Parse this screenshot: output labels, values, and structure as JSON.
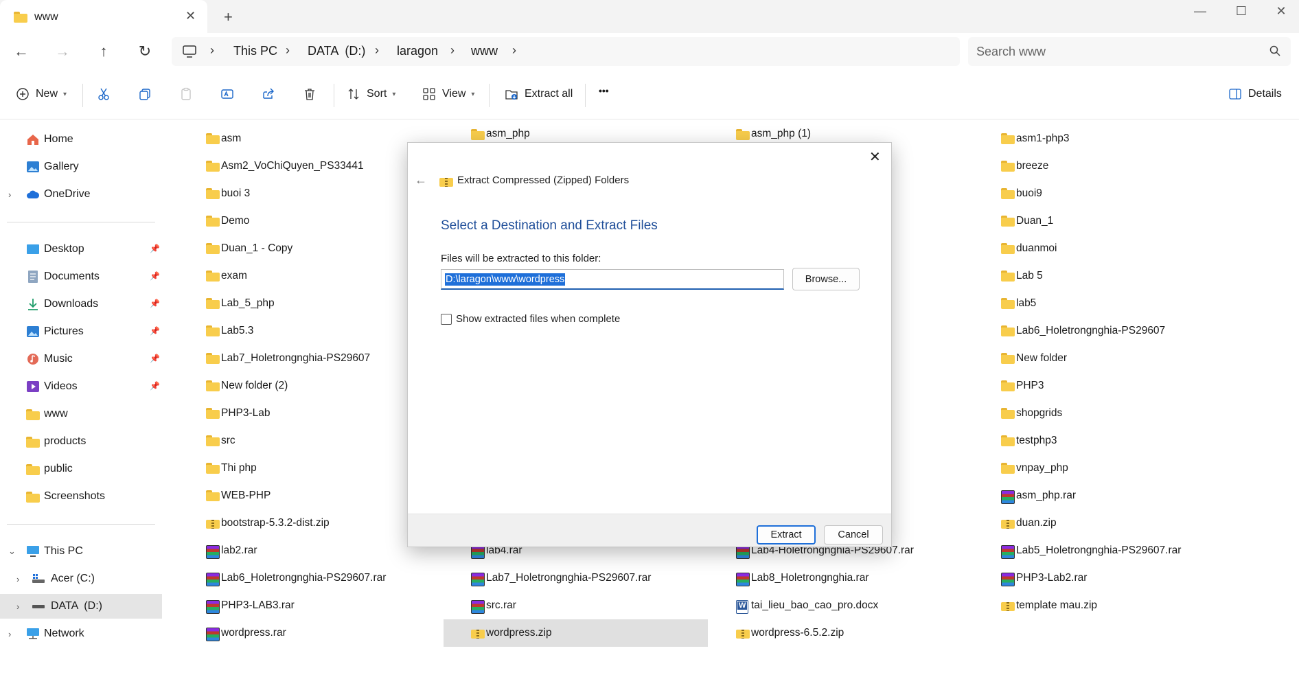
{
  "tab": {
    "title": "www",
    "close": "✕",
    "new_tab": "+"
  },
  "window_controls": {
    "minimize": "—",
    "maximize": "☐",
    "close": "✕"
  },
  "nav": {
    "back": "←",
    "forward": "→",
    "up": "↑",
    "refresh": "↻"
  },
  "breadcrumb": [
    {
      "label": "This PC"
    },
    {
      "label": "DATA  (D:)"
    },
    {
      "label": "laragon"
    },
    {
      "label": "www"
    }
  ],
  "breadcrumb_sep": "›",
  "search": {
    "placeholder": "Search www"
  },
  "commands": {
    "new_label": "New",
    "sort_label": "Sort",
    "view_label": "View",
    "extract_all_label": "Extract all",
    "more_label": "•••",
    "details_label": "Details"
  },
  "sidebar": {
    "top": [
      {
        "label": "Home",
        "icon": "home-icon"
      },
      {
        "label": "Gallery",
        "icon": "gallery-icon"
      },
      {
        "label": "OneDrive",
        "icon": "cloud-icon"
      }
    ],
    "quick": [
      {
        "label": "Desktop",
        "icon": "desktop-icon"
      },
      {
        "label": "Documents",
        "icon": "documents-icon"
      },
      {
        "label": "Downloads",
        "icon": "download-icon"
      },
      {
        "label": "Pictures",
        "icon": "pictures-icon"
      },
      {
        "label": "Music",
        "icon": "music-icon"
      },
      {
        "label": "Videos",
        "icon": "videos-icon"
      },
      {
        "label": "www",
        "icon": "folder-icon"
      },
      {
        "label": "products",
        "icon": "folder-icon"
      },
      {
        "label": "public",
        "icon": "folder-icon"
      },
      {
        "label": "Screenshots",
        "icon": "folder-icon"
      }
    ],
    "devices": [
      {
        "label": "This PC",
        "icon": "pc-icon"
      },
      {
        "label": "Acer (C:)",
        "icon": "drive-icon"
      },
      {
        "label": "DATA  (D:)",
        "icon": "drive-icon"
      },
      {
        "label": "Network",
        "icon": "network-icon"
      }
    ]
  },
  "files": {
    "col1": [
      {
        "name": "asm",
        "type": "folder"
      },
      {
        "name": "Asm2_VoChiQuyen_PS33441",
        "type": "folder"
      },
      {
        "name": "buoi 3",
        "type": "folder"
      },
      {
        "name": "Demo",
        "type": "folder"
      },
      {
        "name": "Duan_1 - Copy",
        "type": "folder"
      },
      {
        "name": "exam",
        "type": "folder"
      },
      {
        "name": "Lab_5_php",
        "type": "folder"
      },
      {
        "name": "Lab5.3",
        "type": "folder"
      },
      {
        "name": "Lab7_Holetrongnghia-PS29607",
        "type": "folder"
      },
      {
        "name": "New folder (2)",
        "type": "folder"
      },
      {
        "name": "PHP3-Lab",
        "type": "folder"
      },
      {
        "name": "src",
        "type": "folder"
      },
      {
        "name": "Thi php",
        "type": "folder"
      },
      {
        "name": "WEB-PHP",
        "type": "folder"
      },
      {
        "name": "bootstrap-5.3.2-dist.zip",
        "type": "zip"
      },
      {
        "name": "lab2.rar",
        "type": "rar"
      },
      {
        "name": "Lab6_Holetrongnghia-PS29607.rar",
        "type": "rar"
      },
      {
        "name": "PHP3-LAB3.rar",
        "type": "rar"
      },
      {
        "name": "wordpress.rar",
        "type": "rar"
      }
    ],
    "col2_top": [
      {
        "name": "asm_php",
        "type": "folder"
      }
    ],
    "col2_bottom": [
      {
        "name": "lab4.rar",
        "type": "rar"
      },
      {
        "name": "Lab7_Holetrongnghia-PS29607.rar",
        "type": "rar"
      },
      {
        "name": "src.rar",
        "type": "rar"
      },
      {
        "name": "wordpress.zip",
        "type": "zip"
      }
    ],
    "col3_top": [
      {
        "name": "asm_php (1)",
        "type": "folder"
      }
    ],
    "col3_bottom": [
      {
        "name": "Lab4-Holetrongnghia-PS29607.rar",
        "type": "rar"
      },
      {
        "name": "Lab8_Holetrongnghia.rar",
        "type": "rar"
      },
      {
        "name": "tai_lieu_bao_cao_pro.docx",
        "type": "docx"
      },
      {
        "name": "wordpress-6.5.2.zip",
        "type": "zip"
      }
    ],
    "col4": [
      {
        "name": "asm1-php3",
        "type": "folder"
      },
      {
        "name": "breeze",
        "type": "folder"
      },
      {
        "name": "buoi9",
        "type": "folder"
      },
      {
        "name": "Duan_1",
        "type": "folder"
      },
      {
        "name": "duanmoi",
        "type": "folder"
      },
      {
        "name": "Lab 5",
        "type": "folder"
      },
      {
        "name": "lab5",
        "type": "folder"
      },
      {
        "name": "Lab6_Holetrongnghia-PS29607",
        "type": "folder"
      },
      {
        "name": "New folder",
        "type": "folder"
      },
      {
        "name": "PHP3",
        "type": "folder"
      },
      {
        "name": "shopgrids",
        "type": "folder"
      },
      {
        "name": "testphp3",
        "type": "folder"
      },
      {
        "name": "vnpay_php",
        "type": "folder"
      },
      {
        "name": "asm_php.rar",
        "type": "rar"
      },
      {
        "name": "duan.zip",
        "type": "zip"
      },
      {
        "name": "Lab5_Holetrongnghia-PS29607.rar",
        "type": "rar"
      },
      {
        "name": "PHP3-Lab2.rar",
        "type": "rar"
      },
      {
        "name": "template mau.zip",
        "type": "zip"
      }
    ]
  },
  "dialog": {
    "title": "Extract Compressed (Zipped) Folders",
    "heading": "Select a Destination and Extract Files",
    "folder_label": "Files will be extracted to this folder:",
    "path_value": "D:\\laragon\\www\\wordpress",
    "browse_label": "Browse...",
    "checkbox_label": "Show extracted files when complete",
    "checkbox_checked": false,
    "extract_label": "Extract",
    "cancel_label": "Cancel",
    "close": "✕",
    "back": "←"
  }
}
